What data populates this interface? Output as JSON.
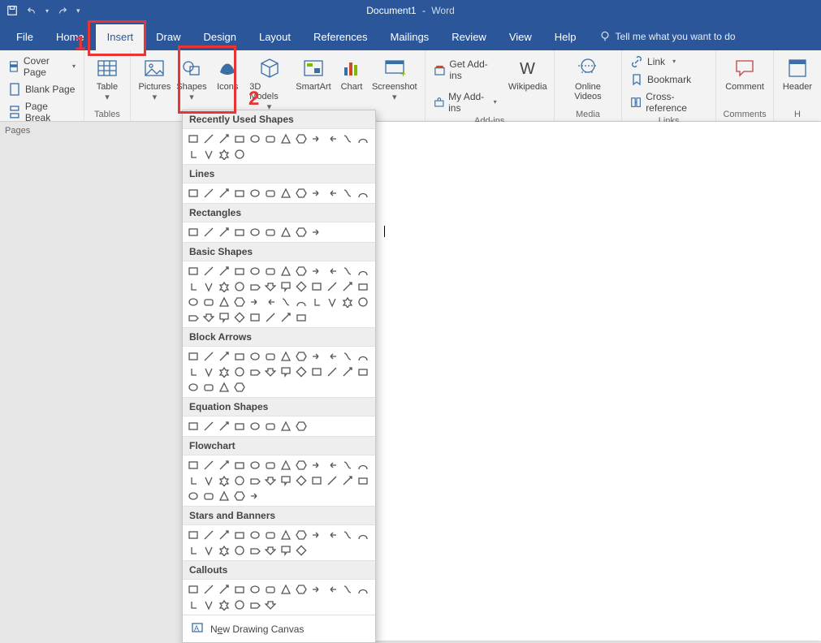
{
  "title": {
    "doc": "Document1",
    "app": "Word"
  },
  "qat": [
    "save",
    "undo",
    "redo",
    "customize"
  ],
  "tabs": [
    "File",
    "Home",
    "Insert",
    "Draw",
    "Design",
    "Layout",
    "References",
    "Mailings",
    "Review",
    "View",
    "Help"
  ],
  "active_tab": "Insert",
  "tellme": "Tell me what you want to do",
  "annotations": {
    "n1": "1",
    "n2": "2"
  },
  "ribbon": {
    "pages": {
      "label": "Pages",
      "cover": "Cover Page",
      "blank": "Blank Page",
      "break": "Page Break"
    },
    "tables": {
      "label": "Tables",
      "table": "Table"
    },
    "illustrations": {
      "pictures": "Pictures",
      "shapes": "Shapes",
      "icons": "Icons",
      "models": "3D Models",
      "smartart": "SmartArt",
      "chart": "Chart",
      "screenshot": "Screenshot"
    },
    "addins": {
      "label": "Add-ins",
      "get": "Get Add-ins",
      "my": "My Add-ins",
      "wiki": "Wikipedia"
    },
    "media": {
      "label": "Media",
      "video": "Online Videos"
    },
    "links": {
      "label": "Links",
      "link": "Link",
      "bookmark": "Bookmark",
      "crossref": "Cross-reference"
    },
    "comments": {
      "label": "Comments",
      "comment": "Comment"
    },
    "header": {
      "header": "Header"
    }
  },
  "shapes_menu": {
    "recently": "Recently Used Shapes",
    "lines": "Lines",
    "rects": "Rectangles",
    "basic": "Basic Shapes",
    "arrows": "Block Arrows",
    "equation": "Equation Shapes",
    "flow": "Flowchart",
    "stars": "Stars and Banners",
    "callouts": "Callouts",
    "canvas_pre": "N",
    "canvas_u": "e",
    "canvas_post": "w Drawing Canvas"
  },
  "counts": {
    "recently": 16,
    "lines": 12,
    "rects": 9,
    "basic": 44,
    "arrows": 28,
    "equation": 8,
    "flow": 29,
    "stars": 20,
    "callouts": 18
  }
}
